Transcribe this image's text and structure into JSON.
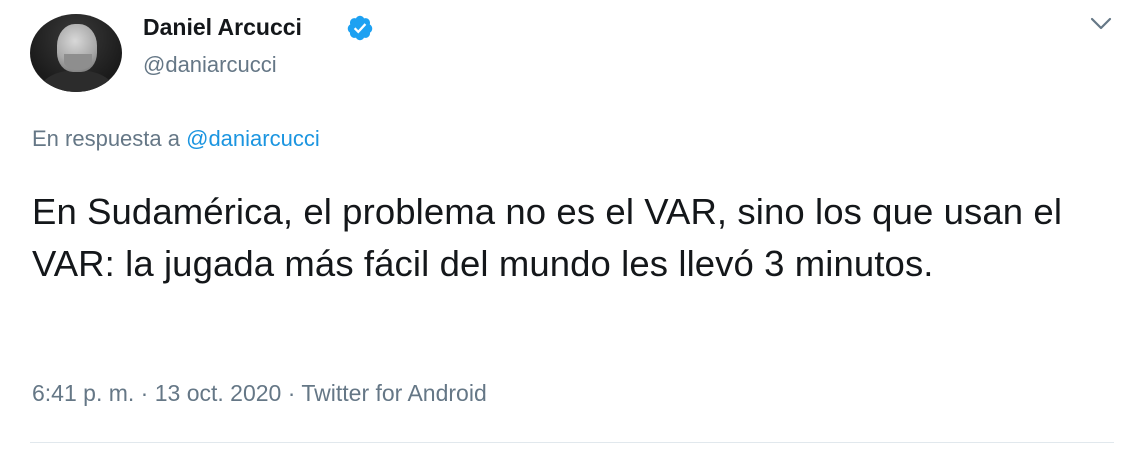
{
  "user": {
    "name": "Daniel Arcucci",
    "handle": "@daniarcucci",
    "verified": true
  },
  "reply_context": {
    "prefix": "En respuesta a",
    "mention": "@daniarcucci"
  },
  "tweet": {
    "text": "En Sudamérica, el problema no es el VAR, sino los que usan el VAR: la jugada más fácil del mundo les llevó 3 minutos."
  },
  "meta": {
    "time": "6:41 p. m.",
    "date": "13 oct. 2020",
    "source": "Twitter for Android",
    "separator": "·"
  },
  "icons": {
    "verified": "verified-badge-icon",
    "menu": "chevron-down-icon"
  },
  "colors": {
    "text": "#14171a",
    "secondary": "#657786",
    "link": "#1b95e0",
    "verified": "#1da1f2"
  }
}
